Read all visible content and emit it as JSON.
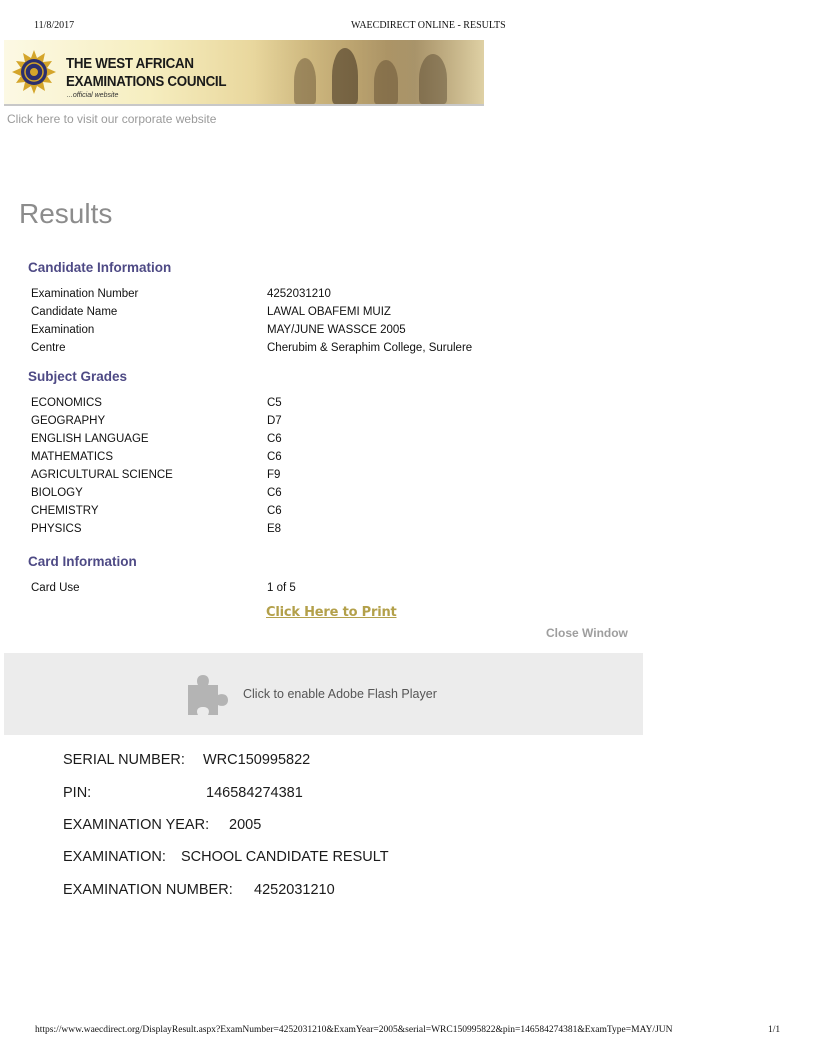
{
  "print_header": {
    "date": "11/8/2017",
    "title": "WAECDIRECT ONLINE - RESULTS"
  },
  "banner": {
    "line1": "THE WEST AFRICAN",
    "line2": "EXAMINATIONS COUNCIL",
    "subtitle": "...official website"
  },
  "corporate_link": "Click here to visit our corporate website",
  "page_heading": "Results",
  "candidate_info": {
    "heading": "Candidate Information",
    "rows": [
      {
        "label": "Examination Number",
        "value": "4252031210"
      },
      {
        "label": "Candidate Name",
        "value": "LAWAL OBAFEMI MUIZ"
      },
      {
        "label": "Examination",
        "value": "MAY/JUNE WASSCE 2005"
      },
      {
        "label": "Centre",
        "value": "Cherubim & Seraphim College, Surulere"
      }
    ]
  },
  "subject_grades": {
    "heading": "Subject Grades",
    "rows": [
      {
        "subject": "ECONOMICS",
        "grade": "C5"
      },
      {
        "subject": "GEOGRAPHY",
        "grade": "D7"
      },
      {
        "subject": "ENGLISH LANGUAGE",
        "grade": "C6"
      },
      {
        "subject": "MATHEMATICS",
        "grade": "C6"
      },
      {
        "subject": "AGRICULTURAL SCIENCE",
        "grade": "F9"
      },
      {
        "subject": "BIOLOGY",
        "grade": "C6"
      },
      {
        "subject": "CHEMISTRY",
        "grade": "C6"
      },
      {
        "subject": "PHYSICS",
        "grade": "E8"
      }
    ]
  },
  "card_info": {
    "heading": "Card Information",
    "rows": [
      {
        "label": "Card Use",
        "value": "1 of 5"
      }
    ]
  },
  "actions": {
    "print_label": "Click Here to Print",
    "close_label": "Close Window"
  },
  "flash": {
    "text": "Click to enable Adobe Flash Player",
    "icon": "puzzle-piece-icon"
  },
  "summary": {
    "serial_label": "SERIAL NUMBER:",
    "serial_value": "WRC150995822",
    "pin_label": "PIN:",
    "pin_value": "146584274381",
    "year_label": "EXAMINATION YEAR:",
    "year_value": "2005",
    "exam_label": "EXAMINATION:",
    "exam_value": "SCHOOL CANDIDATE RESULT",
    "number_label": "EXAMINATION NUMBER:",
    "number_value": "4252031210"
  },
  "print_footer": {
    "url": "https://www.waecdirect.org/DisplayResult.aspx?ExamNumber=4252031210&ExamYear=2005&serial=WRC150995822&pin=146584274381&ExamType=MAY/JUN",
    "page": "1/1"
  },
  "colors": {
    "section_heading": "#4e4a85",
    "print_link": "#b3a04a",
    "muted": "#9e9e9e",
    "flash_bg": "#ececec"
  }
}
